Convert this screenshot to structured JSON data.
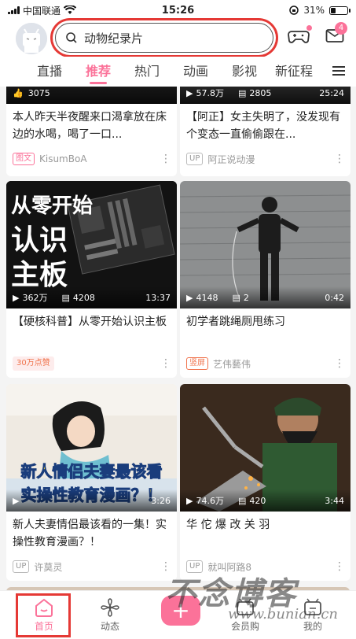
{
  "status_bar": {
    "carrier": "中国联通",
    "time": "15:26",
    "battery": "31%",
    "battery_level": 0.31
  },
  "header": {
    "search_placeholder": "动物纪录片",
    "message_badge": "4"
  },
  "tabs": [
    "直播",
    "推荐",
    "热门",
    "动画",
    "影视",
    "新征程"
  ],
  "active_tab": "推荐",
  "top_cards": [
    {
      "stats": [
        "3075"
      ],
      "title": "本人昨天半夜醒来口渴拿放在床边的水喝，喝了一口...",
      "tag": "图文",
      "author": "KisumBoA"
    },
    {
      "stats": [
        "57.8万",
        "2805"
      ],
      "duration": "25:24",
      "title": "【阿正】女主失明了，没发现有个变态一直偷偷跟在...",
      "tag": "UP",
      "author": "阿正说动漫"
    }
  ],
  "cards": [
    {
      "overlay": [
        "从零开始",
        "认识",
        "主板"
      ],
      "views": "362万",
      "comments": "4208",
      "duration": "13:37",
      "title": "【硬核科普】从零开始认识主板",
      "tag": "30万点赞",
      "author": ""
    },
    {
      "views": "4148",
      "comments": "2",
      "duration": "0:42",
      "title": "初学者跳绳厕甩练习",
      "tag": "竖屏",
      "author": "艺伟藝伟"
    },
    {
      "overlay": [
        "新人情侣夫妻最该看",
        "实操性教育漫画？！"
      ],
      "views": "",
      "comments": "",
      "duration": "3:26",
      "title": "新人夫妻情侣最该看的一集！实操性教育漫画？！",
      "tag": "UP",
      "author": "许莫灵"
    },
    {
      "views": "74.6万",
      "comments": "420",
      "duration": "3:44",
      "title": "华 佗 爆 改 关 羽",
      "tag": "UP",
      "author": "就叫阿路8"
    }
  ],
  "bottom_nav": [
    {
      "label": "首页",
      "icon": "home-icon"
    },
    {
      "label": "动态",
      "icon": "fan-icon"
    },
    {
      "label": "会员购",
      "icon": "tv-icon"
    },
    {
      "label": "我的",
      "icon": "tv-icon"
    }
  ],
  "watermark": {
    "text": "不念博客",
    "sub": "www.bunian.cn"
  },
  "colors": {
    "accent": "#fb7299",
    "highlight_box": "#e53935"
  }
}
